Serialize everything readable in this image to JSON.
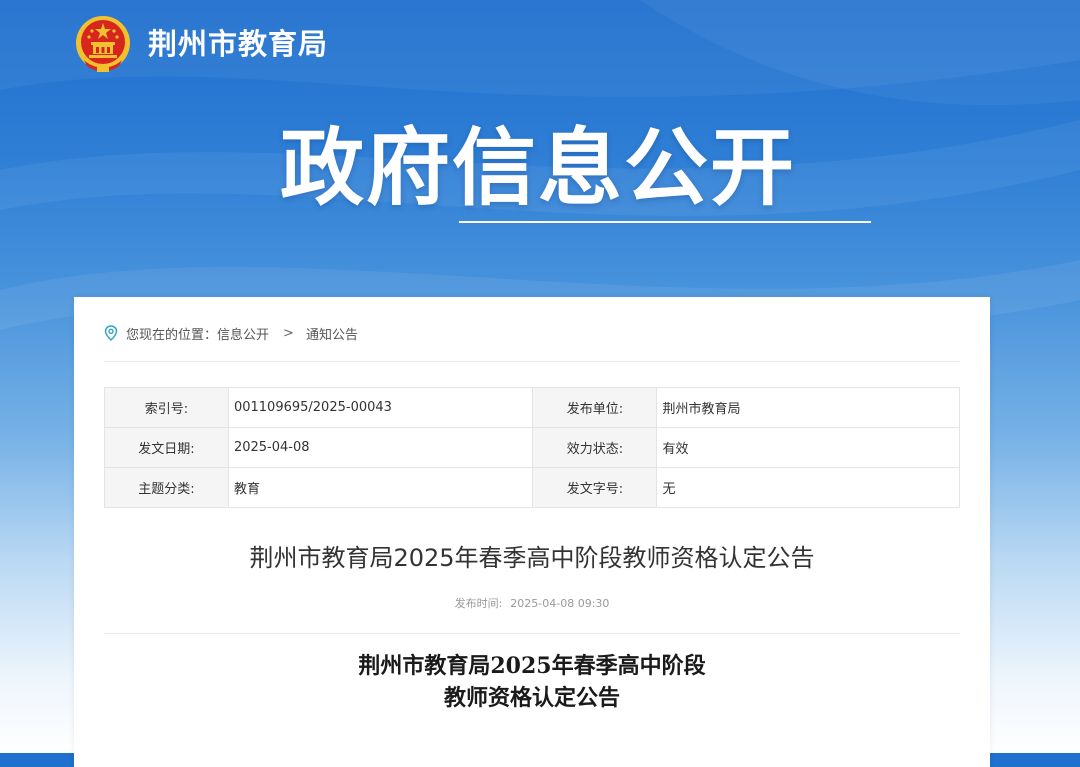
{
  "header": {
    "site_name": "荆州市教育局",
    "emblem_icon": "national-emblem-icon"
  },
  "hero": {
    "title": "政府信息公开"
  },
  "breadcrumb": {
    "prefix": "您现在的位置：",
    "items": [
      "信息公开",
      "通知公告"
    ],
    "separator": ">",
    "icon": "location-pin-icon"
  },
  "meta": {
    "rows": [
      {
        "k1": "索引号:",
        "v1": "001109695/2025-00043",
        "k2": "发布单位:",
        "v2": "荆州市教育局"
      },
      {
        "k1": "发文日期:",
        "v1": "2025-04-08",
        "k2": "效力状态:",
        "v2": "有效"
      },
      {
        "k1": "主题分类:",
        "v1": "教育",
        "k2": "发文字号:",
        "v2": "无"
      }
    ]
  },
  "article": {
    "title": "荆州市教育局2025年春季高中阶段教师资格认定公告",
    "pub_label": "发布时间:",
    "pub_time": "2025-04-08 09:30",
    "body_title_line1": "荆州市教育局2025年春季高中阶段",
    "body_title_line2": "教师资格认定公告"
  },
  "colors": {
    "header_blue": "#1f6fce",
    "emblem_red": "#d7261e",
    "emblem_gold": "#f3c12e"
  }
}
